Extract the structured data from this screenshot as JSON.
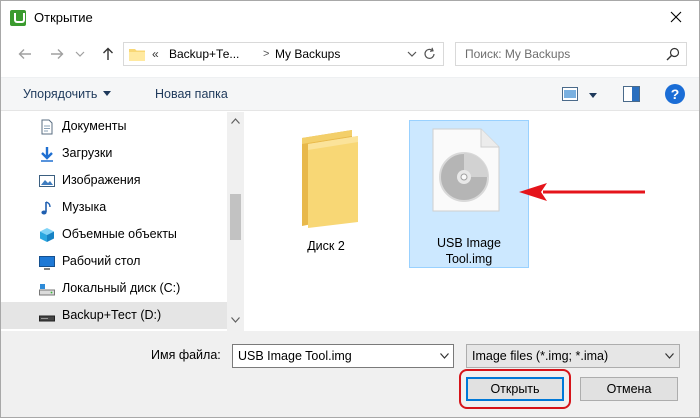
{
  "window": {
    "title": "Открытие"
  },
  "nav": {
    "back": "back",
    "forward": "forward",
    "up": "up",
    "address": {
      "overflow": "«",
      "segments": [
        "Backup+Те...",
        "My Backups"
      ]
    },
    "search_placeholder": "Поиск: My Backups"
  },
  "toolbar": {
    "organize_label": "Упорядочить",
    "new_folder_label": "Новая папка",
    "help_label": "?"
  },
  "sidebar": {
    "items": [
      {
        "label": "Документы",
        "icon": "documents-icon"
      },
      {
        "label": "Загрузки",
        "icon": "downloads-icon"
      },
      {
        "label": "Изображения",
        "icon": "pictures-icon"
      },
      {
        "label": "Музыка",
        "icon": "music-icon"
      },
      {
        "label": "Объемные объекты",
        "icon": "3d-objects-icon"
      },
      {
        "label": "Рабочий стол",
        "icon": "desktop-icon"
      },
      {
        "label": "Локальный диск (C:)",
        "icon": "local-disk-icon"
      },
      {
        "label": "Backup+Тест (D:)",
        "icon": "external-drive-icon",
        "selected": true
      }
    ]
  },
  "files": [
    {
      "name": "Диск 2",
      "type": "folder",
      "selected": false
    },
    {
      "name_line1": "USB Image",
      "name_line2": "Tool.img",
      "type": "disc-image",
      "selected": true
    }
  ],
  "footer": {
    "filename_label": "Имя файла:",
    "filename_value": "USB Image Tool.img",
    "filetype_value": "Image files (*.img; *.ima)",
    "open_label": "Открыть",
    "cancel_label": "Отмена"
  },
  "colors": {
    "accent": "#0078d7",
    "selection": "#cce8ff",
    "annotation": "#e5141b",
    "app_icon": "#3a9b2e"
  }
}
